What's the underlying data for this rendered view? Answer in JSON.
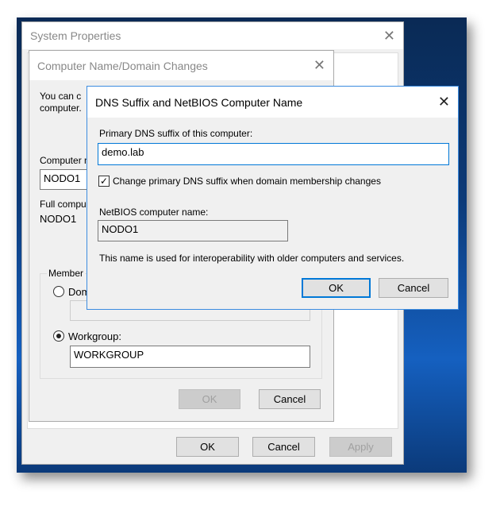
{
  "system_properties": {
    "title": "System Properties",
    "ok": "OK",
    "cancel": "Cancel",
    "apply": "Apply"
  },
  "computer_name_dialog": {
    "title": "Computer Name/Domain Changes",
    "intro_line1": "You can c",
    "intro_line2": "computer.",
    "computer_name_label": "Computer n",
    "computer_name_value": "NODO1",
    "full_name_label": "Full compu",
    "full_name_value": "NODO1",
    "member_of_label": "Member",
    "domain_label": "Dom",
    "domain_value": "",
    "workgroup_label": "Workgroup:",
    "workgroup_value": "WORKGROUP",
    "ok": "OK",
    "cancel": "Cancel"
  },
  "dns_dialog": {
    "title": "DNS Suffix and NetBIOS Computer Name",
    "suffix_label": "Primary DNS suffix of this computer:",
    "suffix_value": "demo.lab",
    "checkbox_label": "Change primary DNS suffix when domain membership changes",
    "checkbox_checked": true,
    "netbios_label": "NetBIOS computer name:",
    "netbios_value": "NODO1",
    "note": "This name is used for interoperability with older computers and services.",
    "ok": "OK",
    "cancel": "Cancel"
  },
  "colors": {
    "accent": "#0078d7"
  }
}
